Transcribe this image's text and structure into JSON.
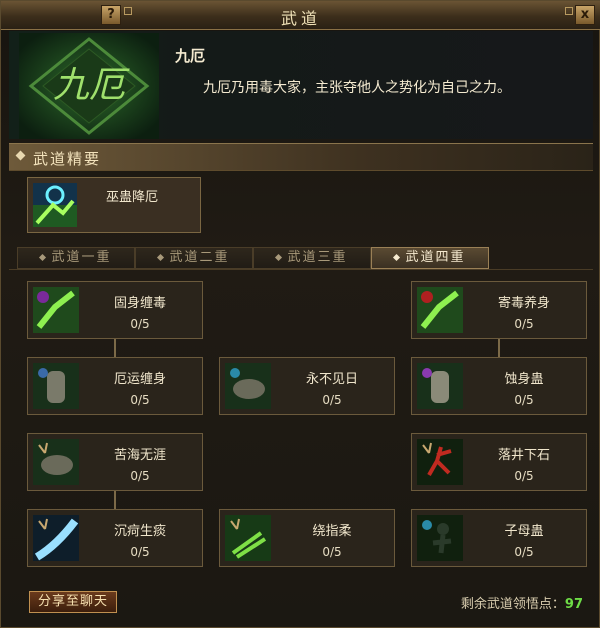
{
  "window": {
    "title": "武道",
    "help_label": "?",
    "close_label": "x"
  },
  "header": {
    "emblem_text": "九厄",
    "name": "九厄",
    "description": "九厄乃用毒大家，主张夺他人之势化为自己之力。"
  },
  "section": {
    "label": "武道精要"
  },
  "featured_skill": {
    "name": "巫蛊降厄",
    "icon": "poison-claw-icon"
  },
  "tabs": [
    {
      "label": "武道一重",
      "active": false
    },
    {
      "label": "武道二重",
      "active": false
    },
    {
      "label": "武道三重",
      "active": false
    },
    {
      "label": "武道四重",
      "active": true
    }
  ],
  "skills": [
    {
      "name": "固身缠毒",
      "level": "0/5",
      "icon": "green-claw-icon"
    },
    {
      "name": "寄毒养身",
      "level": "0/5",
      "icon": "green-claw-icon"
    },
    {
      "name": "厄运缠身",
      "level": "0/5",
      "icon": "gauntlet-icon"
    },
    {
      "name": "永不见日",
      "level": "0/5",
      "icon": "gauntlet-icon"
    },
    {
      "name": "蚀身蛊",
      "level": "0/5",
      "icon": "gauntlet-icon"
    },
    {
      "name": "苦海无涯",
      "level": "0/5",
      "icon": "gauntlet-icon"
    },
    {
      "name": "落井下石",
      "level": "0/5",
      "icon": "red-figure-icon"
    },
    {
      "name": "沉疴生痰",
      "level": "0/5",
      "icon": "blue-slash-icon"
    },
    {
      "name": "绕指柔",
      "level": "0/5",
      "icon": "green-hand-icon"
    },
    {
      "name": "子母蛊",
      "level": "0/5",
      "icon": "shadow-figure-icon"
    }
  ],
  "footer": {
    "share_label": "分享至聊天",
    "points_label": "剩余武道领悟点：",
    "points_value": "97"
  },
  "colors": {
    "accent_green": "#6edc46",
    "gold": "#c09050"
  }
}
